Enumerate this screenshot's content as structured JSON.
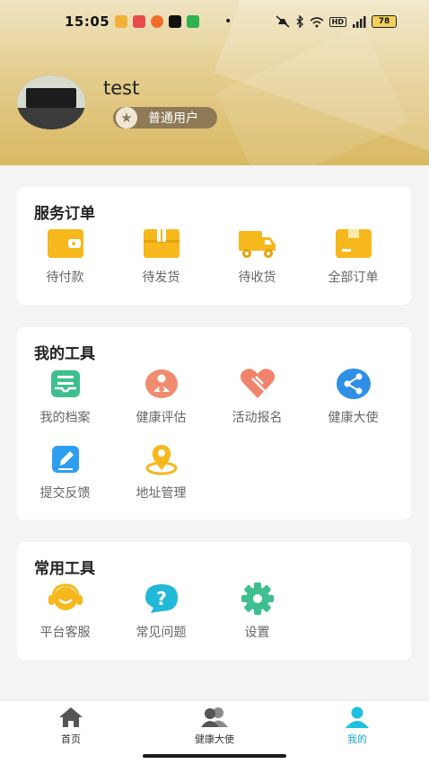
{
  "status_bar": {
    "time": "15:05",
    "battery": "78",
    "hd": "HD",
    "dot": "•"
  },
  "profile": {
    "username": "test",
    "level_badge": "普通用户"
  },
  "service_orders": {
    "title": "服务订单",
    "items": [
      {
        "label": "待付款",
        "icon": "wallet-icon"
      },
      {
        "label": "待发货",
        "icon": "package-icon"
      },
      {
        "label": "待收货",
        "icon": "truck-icon"
      },
      {
        "label": "全部订单",
        "icon": "box-icon"
      }
    ]
  },
  "my_tools": {
    "title": "我的工具",
    "items": [
      {
        "label": "我的档案",
        "icon": "archive-icon"
      },
      {
        "label": "健康评估",
        "icon": "health-assessment-icon"
      },
      {
        "label": "活动报名",
        "icon": "heart-icon"
      },
      {
        "label": "健康大使",
        "icon": "share-icon"
      },
      {
        "label": "提交反馈",
        "icon": "edit-icon"
      },
      {
        "label": "地址管理",
        "icon": "location-icon"
      }
    ]
  },
  "common_tools": {
    "title": "常用工具",
    "items": [
      {
        "label": "平台客服",
        "icon": "headset-icon"
      },
      {
        "label": "常见问题",
        "icon": "question-icon"
      },
      {
        "label": "设置",
        "icon": "gear-icon"
      }
    ]
  },
  "bottom_nav": {
    "tabs": [
      {
        "label": "首页",
        "icon": "home-icon",
        "active": false
      },
      {
        "label": "健康大使",
        "icon": "group-icon",
        "active": false
      },
      {
        "label": "我的",
        "icon": "person-icon",
        "active": true
      }
    ]
  },
  "colors": {
    "accent_orange": "#f6b81c",
    "active_tab": "#1aa7d9",
    "badge_bg": "#8e7a56"
  }
}
